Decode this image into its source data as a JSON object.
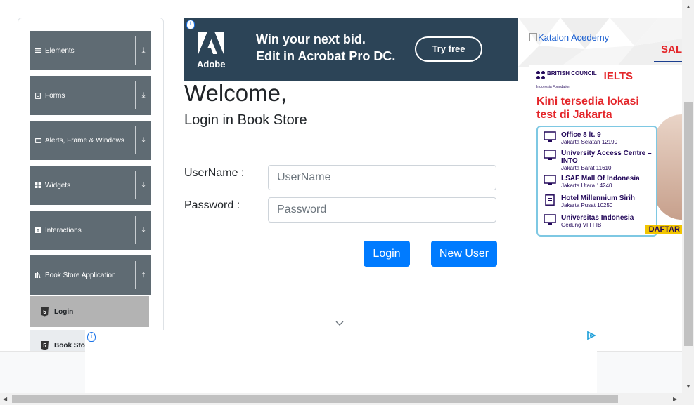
{
  "sidebar": {
    "groups": [
      {
        "label": "Elements",
        "icon": "list-icon",
        "arrow": "⤓"
      },
      {
        "label": "Forms",
        "icon": "document-icon",
        "arrow": "⤓"
      },
      {
        "label": "Alerts, Frame & Windows",
        "icon": "window-icon",
        "arrow": "⤓"
      },
      {
        "label": "Widgets",
        "icon": "grid-icon",
        "arrow": "⤓"
      },
      {
        "label": "Interactions",
        "icon": "box-icon",
        "arrow": "⤓"
      },
      {
        "label": "Book Store Application",
        "icon": "books-icon",
        "arrow": "⤒"
      }
    ],
    "items": [
      {
        "label": "Login",
        "icon": "html5-icon",
        "active": true
      },
      {
        "label": "Book Store",
        "icon": "html5-icon",
        "active": false
      }
    ]
  },
  "top_ad": {
    "brand": "Adobe",
    "line1": "Win your next bid.",
    "line2": "Edit in Acrobat Pro DC.",
    "cta": "Try free"
  },
  "main": {
    "heading": "Welcome,",
    "subheading": "Login in Book Store",
    "username_label": "UserName :",
    "username_placeholder": "UserName",
    "password_label": "Password :",
    "password_placeholder": "Password",
    "login_button": "Login",
    "new_user_button": "New User"
  },
  "right_ad": {
    "image_alt": "Katalon Acedemy",
    "partial_text": "SAL",
    "ielts": {
      "british_council": "BRITISH COUNCIL",
      "logo": "IELTS",
      "foundation": "Indonesia Foundation",
      "headline": "Kini tersedia lokasi test di Jakarta",
      "locations": [
        {
          "name": "Office 8 lt. 9",
          "address": "Jakarta Selatan 12190"
        },
        {
          "name": "University Access Centre – INTO",
          "address": "Jakarta Barat 11610"
        },
        {
          "name": "LSAF Mall Of Indonesia",
          "address": "Jakarta Utara 14240"
        },
        {
          "name": "Hotel Millennium Sirih",
          "address": "Jakarta Pusat 10250"
        },
        {
          "name": "Universitas Indonesia",
          "address": "Gedung VIII FIB"
        }
      ],
      "cta": "DAFTAR"
    }
  },
  "colors": {
    "primary": "#007bff",
    "sidebar_header": "#5f6b73",
    "active_item": "#b3b3b3",
    "ad_background": "#2c4457",
    "ielts_red": "#e4262a",
    "ielts_navy": "#23085a"
  }
}
